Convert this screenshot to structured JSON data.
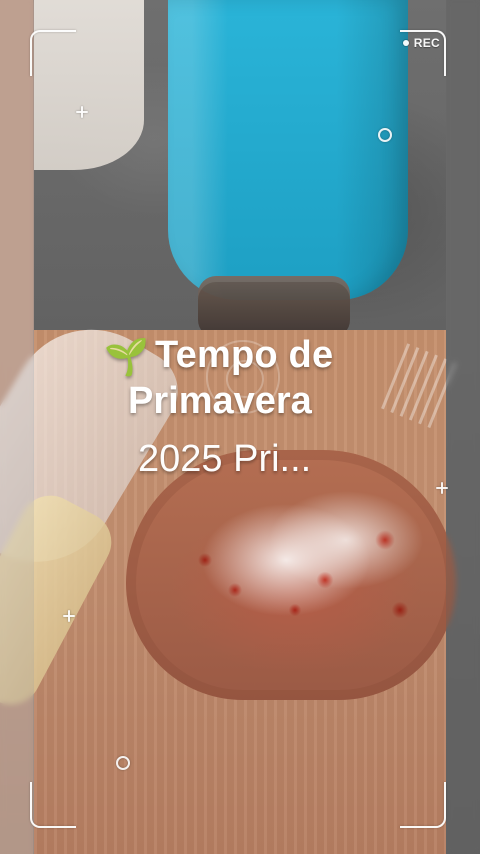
{
  "overlay": {
    "rec_label": "REC",
    "caption": {
      "emoji": "🌱",
      "line1": "Tempo de",
      "line2": "Primavera",
      "line3": "2025 Pri..."
    }
  },
  "icons": {
    "rec_dot": "rec-dot-icon",
    "sprout": "sprout-icon",
    "crosshair_plus": "plus-icon",
    "crosshair_ring": "ring-icon"
  },
  "colors": {
    "overlay_white": "#ffffff",
    "cup_blue": "#1d9fc3",
    "sauce_red": "#e63723"
  }
}
